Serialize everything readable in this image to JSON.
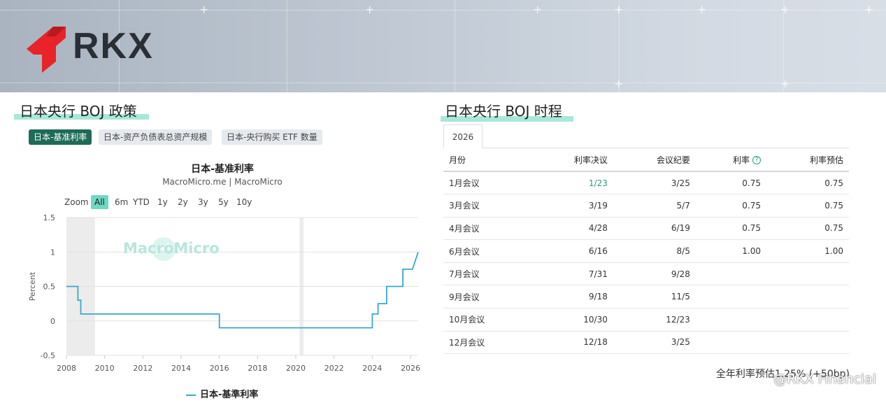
{
  "brand": {
    "logo_text": "RKX",
    "logo_accent": "#e8232a"
  },
  "left": {
    "section_title": "日本央行 BOJ 政策",
    "tabs": [
      {
        "label": "日本-基准利率",
        "active": true
      },
      {
        "label": "日本-资产负债表总资产规模",
        "active": false
      },
      {
        "label": "日本-央行购买 ETF 数量",
        "active": false
      }
    ],
    "chart": {
      "title": "日本-基准利率",
      "subtitle": "MacroMicro.me | MacroMicro",
      "zoom_label": "Zoom",
      "zoom_options": [
        "All",
        "6m",
        "YTD",
        "1y",
        "2y",
        "3y",
        "5y",
        "10y"
      ],
      "zoom_active": "All",
      "watermark": "MacroMicro",
      "legend": "日本-基準利率"
    }
  },
  "chart_data": {
    "type": "line",
    "ylabel": "Percent",
    "xlabel": "",
    "ylim": [
      -0.5,
      1.5
    ],
    "xlim": [
      2008,
      2026.4
    ],
    "y_ticks": [
      "1.5",
      "1",
      "0.5",
      "0",
      "-0.5"
    ],
    "x_ticks": [
      "2008",
      "2010",
      "2012",
      "2014",
      "2016",
      "2018",
      "2020",
      "2022",
      "2024",
      "2026"
    ],
    "recession_bands": [
      [
        2008.0,
        2009.5
      ],
      [
        2020.2,
        2020.4
      ]
    ],
    "series": [
      {
        "name": "日本-基準利率",
        "color": "#3aa7c8",
        "points": [
          [
            2008.0,
            0.5
          ],
          [
            2008.6,
            0.5
          ],
          [
            2008.6,
            0.3
          ],
          [
            2008.75,
            0.3
          ],
          [
            2008.75,
            0.1
          ],
          [
            2016.0,
            0.1
          ],
          [
            2016.0,
            -0.1
          ],
          [
            2024.0,
            -0.1
          ],
          [
            2024.0,
            0.1
          ],
          [
            2024.3,
            0.1
          ],
          [
            2024.3,
            0.25
          ],
          [
            2024.75,
            0.25
          ],
          [
            2024.75,
            0.5
          ],
          [
            2025.6,
            0.5
          ],
          [
            2025.6,
            0.75
          ],
          [
            2026.1,
            0.75
          ],
          [
            2026.4,
            1.0
          ]
        ]
      }
    ]
  },
  "right": {
    "section_title": "日本央行 BOJ 时程",
    "year_tab": "2026",
    "columns": [
      "月份",
      "利率决议",
      "会议纪要",
      "利率",
      "利率预估"
    ],
    "rows": [
      [
        "1月会议",
        "1/23",
        "3/25",
        "0.75",
        "0.75"
      ],
      [
        "3月会议",
        "3/19",
        "5/7",
        "0.75",
        "0.75"
      ],
      [
        "4月会议",
        "4/28",
        "6/19",
        "0.75",
        "0.75"
      ],
      [
        "6月会议",
        "6/16",
        "8/5",
        "1.00",
        "1.00"
      ],
      [
        "7月会议",
        "7/31",
        "9/28",
        "",
        ""
      ],
      [
        "9月会议",
        "9/18",
        "11/5",
        "",
        ""
      ],
      [
        "10月会议",
        "10/30",
        "12/23",
        "",
        ""
      ],
      [
        "12月会议",
        "12/18",
        "3/25",
        "",
        ""
      ]
    ],
    "summary": "全年利率预估1.25% (+50bp)"
  },
  "corner_watermark": "@RKX Financial"
}
